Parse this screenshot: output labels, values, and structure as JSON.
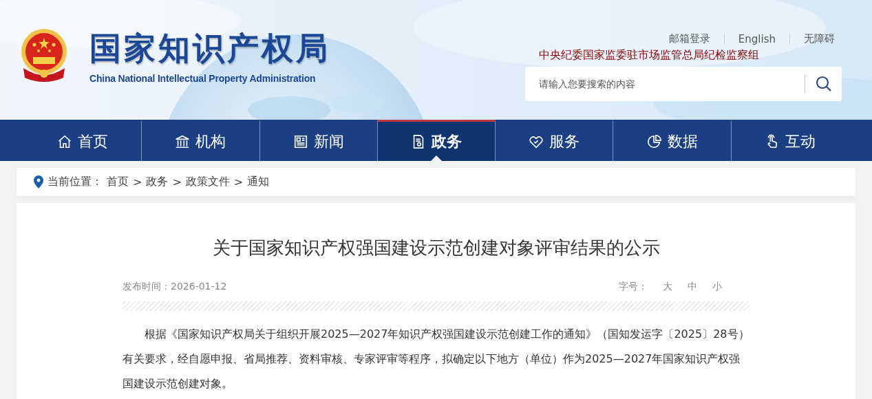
{
  "header": {
    "site_name": "国家知识产权局",
    "site_name_en": "China National Intellectual Property Administration",
    "top_links": [
      "邮箱登录",
      "English",
      "无障碍"
    ],
    "notice": "中央纪委国家监委驻市场监管总局纪检监察组",
    "search": {
      "placeholder": "请输入您要搜索的内容"
    }
  },
  "nav": [
    {
      "label": "首页",
      "kind": "home",
      "selected": false
    },
    {
      "label": "机构",
      "kind": "institution",
      "selected": false
    },
    {
      "label": "新闻",
      "kind": "news",
      "selected": false
    },
    {
      "label": "政务",
      "kind": "document",
      "selected": true
    },
    {
      "label": "服务",
      "kind": "service",
      "selected": false
    },
    {
      "label": "数据",
      "kind": "chart",
      "selected": false
    },
    {
      "label": "互动",
      "kind": "hand",
      "selected": false
    }
  ],
  "breadcrumb": {
    "label": "当前位置：",
    "items": [
      "首页",
      "政务",
      "政策文件",
      "通知"
    ],
    "separator": ">"
  },
  "article": {
    "title": "关于国家知识产权强国建设示范创建对象评审结果的公示",
    "published": "发布时间：2026-01-12",
    "font_size": {
      "label": "字号：",
      "options": [
        "大",
        "中",
        "小"
      ]
    },
    "paragraphs": [
      "根据《国家知识产权局关于组织开展2025—2027年知识产权强国建设示范创建工作的通知》（国知发运字〔2025〕28号）有关要求，经自愿申报、省局推荐、资料审核、专家评审等程序，拟确定以下地方（单位）作为2025—2027年国家知识产权强国建设示范创建对象。"
    ]
  }
}
